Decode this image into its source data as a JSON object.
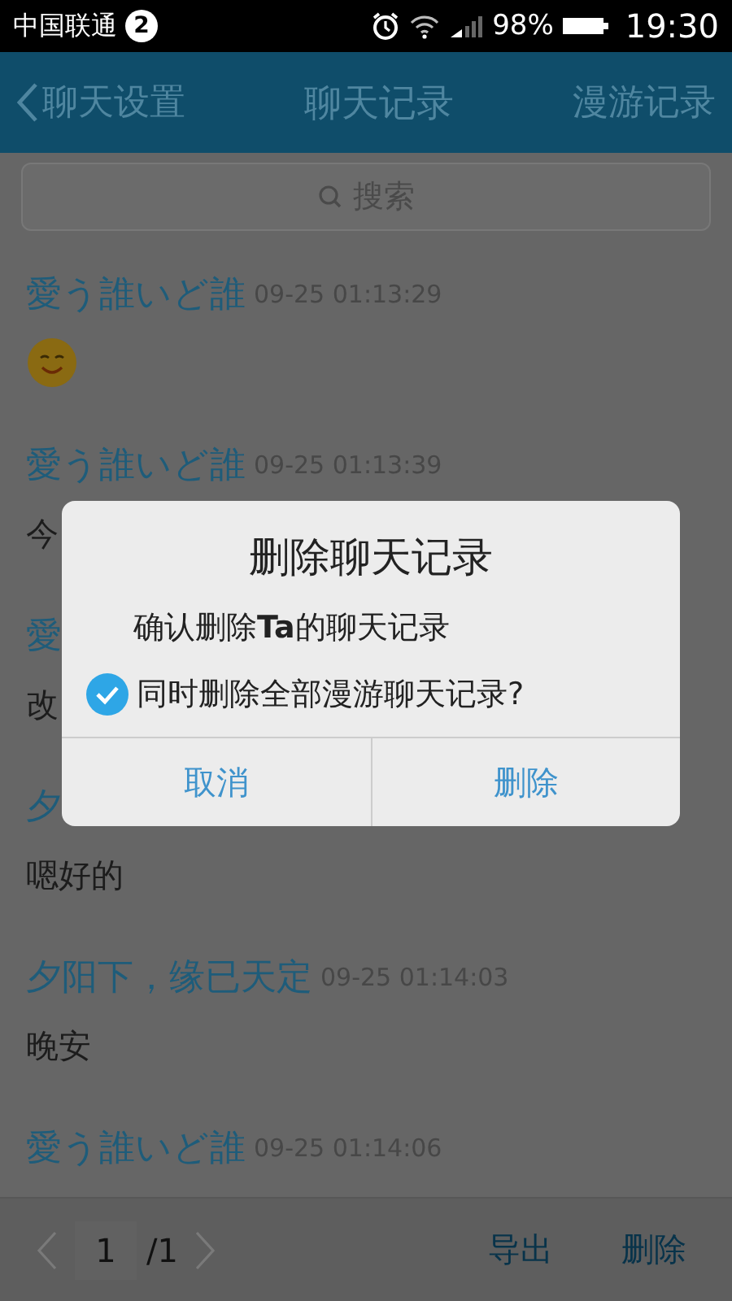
{
  "status_bar": {
    "carrier": "中国联通",
    "notification_count": "2",
    "battery": "98%",
    "time": "19:30"
  },
  "nav": {
    "back": "聊天设置",
    "title": "聊天记录",
    "action": "漫游记录"
  },
  "search": {
    "placeholder": "搜索"
  },
  "messages": [
    {
      "sender": "愛う誰いど誰",
      "time": "09-25 01:13:29",
      "kind": "emoji"
    },
    {
      "sender": "愛う誰いど誰",
      "time": "09-25 01:13:39",
      "kind": "text",
      "text": "今"
    },
    {
      "sender": "愛",
      "kind": "text",
      "text": "改"
    },
    {
      "sender": "夕",
      "kind": "text",
      "text": "嗯好的"
    },
    {
      "sender": "夕阳下，缘已天定",
      "time": "09-25 01:14:03",
      "kind": "text",
      "text": "晚安"
    },
    {
      "sender": "愛う誰いど誰",
      "time": "09-25 01:14:06"
    }
  ],
  "dialog": {
    "title": "删除聊天记录",
    "message": "确认删除**Ta**的聊天记录",
    "option": {
      "label": "同时删除全部漫游聊天记录?",
      "checked": true
    },
    "buttons": [
      "取消",
      "删除"
    ]
  },
  "pager": {
    "page": "1",
    "total": "/1"
  },
  "actions": [
    "导出",
    "删除"
  ]
}
